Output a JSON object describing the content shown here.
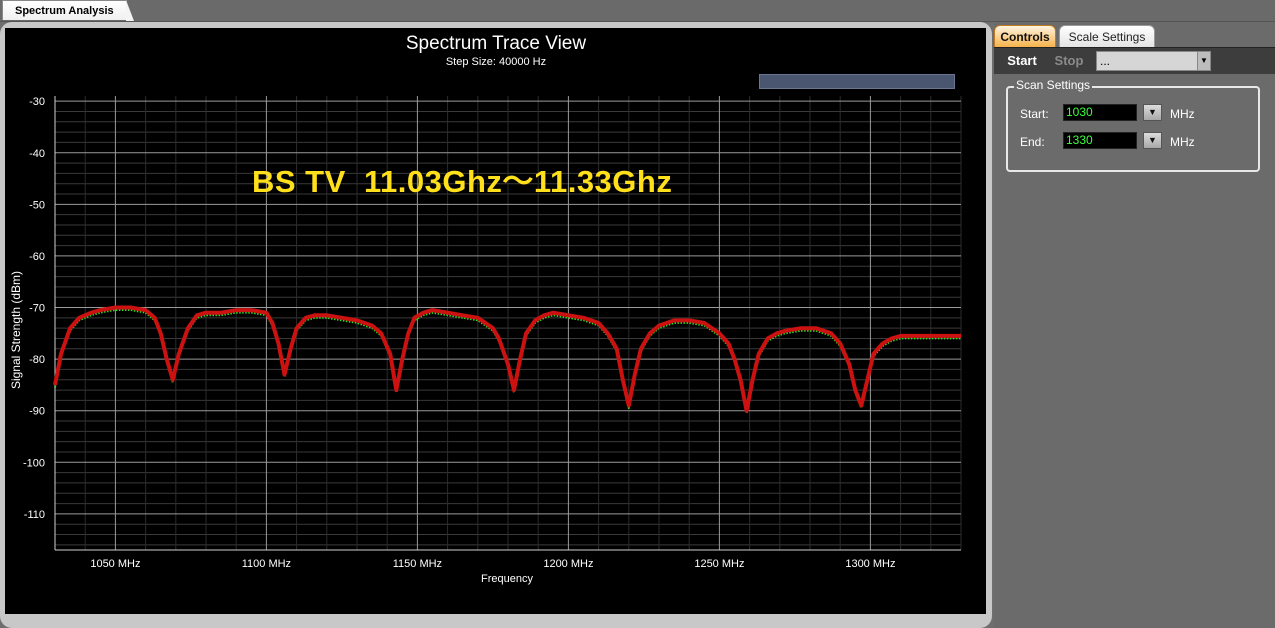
{
  "top_tab": {
    "label": "Spectrum Analysis"
  },
  "chart_panel": {
    "overlay_text": "BS TV  11.03Ghz～11.33Ghz",
    "progress": 0
  },
  "right_panel": {
    "tabs": [
      {
        "label": "Controls",
        "active": true
      },
      {
        "label": "Scale Settings",
        "active": false
      }
    ],
    "toolbar": {
      "start_label": "Start",
      "stop_label": "Stop",
      "device_value": "..."
    },
    "scan_settings": {
      "title": "Scan Settings",
      "start_label": "Start:",
      "start_value": "1030",
      "end_label": "End:",
      "end_value": "1330",
      "unit": "MHz"
    }
  },
  "colors": {
    "trace_max": "#cc1111",
    "trace_live": "#33dd22",
    "overlay_text": "#ffe01a",
    "controls_tab": "#f6b24a"
  },
  "chart_data": {
    "type": "line",
    "title": "Spectrum Trace View",
    "subtitle": "Step Size: 40000 Hz",
    "xlabel": "Frequency",
    "ylabel": "Signal Strength (dBm)",
    "xlim": [
      1030,
      1330
    ],
    "ylim": [
      -117,
      -29
    ],
    "x_ticks": [
      1050,
      1100,
      1150,
      1200,
      1250,
      1300
    ],
    "x_tick_labels": [
      "1050 MHz",
      "1100 MHz",
      "1150 MHz",
      "1200 MHz",
      "1250 MHz",
      "1300 MHz"
    ],
    "y_ticks": [
      -30,
      -40,
      -50,
      -60,
      -70,
      -80,
      -90,
      -100,
      -110
    ],
    "y_tick_labels": [
      "-30",
      "-40",
      "-50",
      "-60",
      "-70",
      "-80",
      "-90",
      "-100",
      "-110"
    ],
    "grid": true,
    "series": [
      {
        "x": [
          1030,
          1032,
          1035,
          1038,
          1042,
          1045,
          1050,
          1055,
          1060,
          1063,
          1065,
          1067,
          1069,
          1071,
          1074,
          1077,
          1080,
          1085,
          1090,
          1095,
          1100,
          1102,
          1104,
          1106,
          1108,
          1110,
          1113,
          1116,
          1120,
          1125,
          1130,
          1135,
          1138,
          1141,
          1143,
          1145,
          1147,
          1149,
          1152,
          1155,
          1160,
          1165,
          1170,
          1175,
          1177,
          1180,
          1182,
          1184,
          1186,
          1189,
          1192,
          1195,
          1200,
          1205,
          1210,
          1213,
          1216,
          1218,
          1220,
          1222,
          1224,
          1227,
          1230,
          1235,
          1240,
          1245,
          1250,
          1253,
          1255,
          1257,
          1259,
          1261,
          1263,
          1266,
          1269,
          1272,
          1277,
          1282,
          1287,
          1290,
          1293,
          1295,
          1297,
          1299,
          1301,
          1304,
          1307,
          1310,
          1315,
          1320,
          1325,
          1330
        ],
        "y": [
          -85,
          -79,
          -74,
          -72,
          -71,
          -70.5,
          -70,
          -70,
          -70.5,
          -72,
          -75,
          -80,
          -84,
          -79,
          -74,
          -71.5,
          -71,
          -71,
          -70.5,
          -70.5,
          -71,
          -73,
          -77,
          -83,
          -78,
          -74,
          -72,
          -71.5,
          -71.5,
          -72,
          -72.5,
          -73.5,
          -75,
          -79,
          -86,
          -80,
          -75,
          -72,
          -71,
          -70.5,
          -71,
          -71.5,
          -72,
          -74,
          -76,
          -81,
          -86,
          -80,
          -75,
          -72.5,
          -71.5,
          -71,
          -71.5,
          -72,
          -73,
          -75,
          -78,
          -84,
          -89,
          -83,
          -78,
          -75,
          -73.5,
          -72.5,
          -72.5,
          -73,
          -75,
          -77,
          -80,
          -84,
          -90,
          -84,
          -79,
          -76,
          -75,
          -74.5,
          -74,
          -74,
          -75,
          -77,
          -81,
          -86,
          -89,
          -84,
          -79,
          -77,
          -76,
          -75.5,
          -75.5,
          -75.5,
          -75.5,
          -75.5
        ]
      }
    ]
  }
}
